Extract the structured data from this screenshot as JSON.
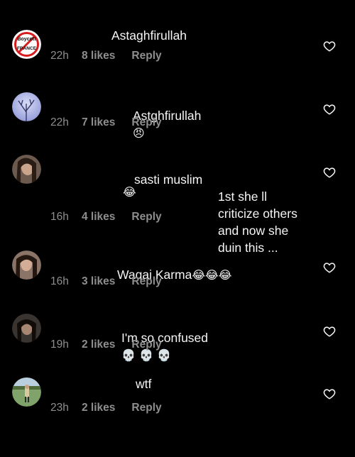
{
  "comments": [
    {
      "text": "Astaghfirullah",
      "emoji": "",
      "time": "22h",
      "likes": "8 likes",
      "reply": "Reply"
    },
    {
      "text": "Astghfirullah",
      "emoji": "😠",
      "time": "22h",
      "likes": "7 likes",
      "reply": "Reply"
    },
    {
      "text": "sasti muslim\n1st she ll criticize others and now she duin this ...",
      "emoji": "😂",
      "time": "16h",
      "likes": "4 likes",
      "reply": "Reply"
    },
    {
      "text": "Waqai Karma",
      "emoji": "😂😂😂",
      "time": "16h",
      "likes": "3 likes",
      "reply": "Reply"
    },
    {
      "text": "I'm so confused",
      "emoji": "💀 💀 💀",
      "time": "19h",
      "likes": "2 likes",
      "reply": "Reply"
    },
    {
      "text": "wtf",
      "emoji": "",
      "time": "23h",
      "likes": "2 likes",
      "reply": "Reply"
    }
  ],
  "avatar_badge": {
    "line1": "Boycott",
    "line2": "FRANCE"
  },
  "icons": {
    "like": "heart-outline-icon"
  },
  "colors": {
    "background": "#000000",
    "text": "#f5f5f5",
    "meta": "#8e8e8e"
  }
}
